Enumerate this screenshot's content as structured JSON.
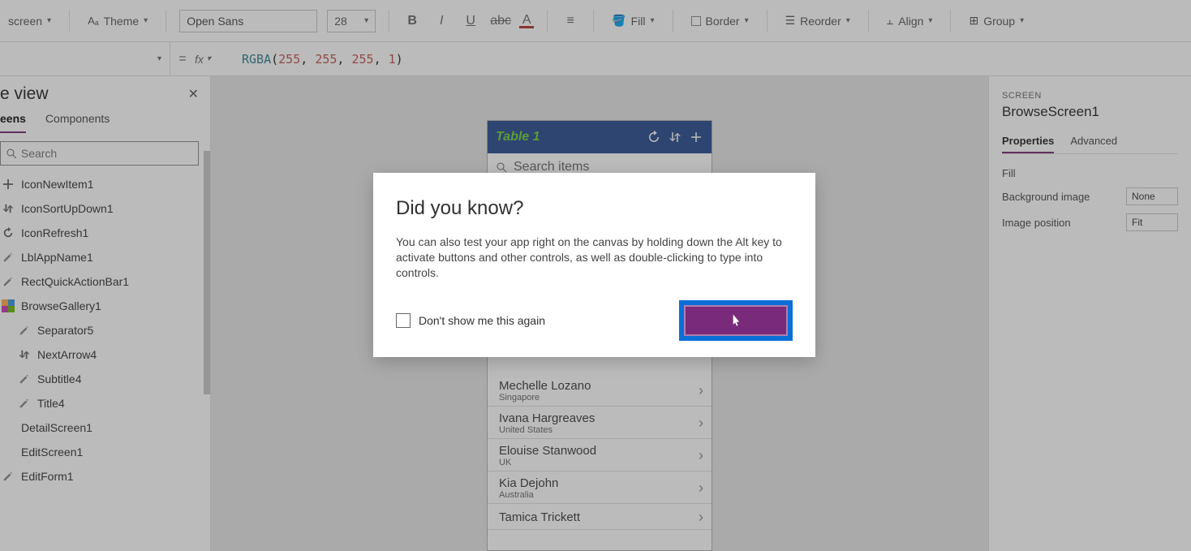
{
  "toolbar": {
    "screen_label": "screen",
    "theme_label": "Theme",
    "font_name": "Open Sans",
    "font_size": "28",
    "fill_label": "Fill",
    "border_label": "Border",
    "reorder_label": "Reorder",
    "align_label": "Align",
    "group_label": "Group"
  },
  "formula": {
    "fn": "RGBA",
    "args": [
      "255",
      "255",
      "255",
      "1"
    ]
  },
  "tree": {
    "title": "e view",
    "tabs": {
      "screens": "eens",
      "components": "Components"
    },
    "search_placeholder": "Search",
    "items": [
      {
        "name": "IconNewItem1",
        "icon": "add",
        "ind": 0
      },
      {
        "name": "IconSortUpDown1",
        "icon": "sort",
        "ind": 0
      },
      {
        "name": "IconRefresh1",
        "icon": "refresh",
        "ind": 0
      },
      {
        "name": "LblAppName1",
        "icon": "edit",
        "ind": 0
      },
      {
        "name": "RectQuickActionBar1",
        "icon": "edit",
        "ind": 0
      },
      {
        "name": "BrowseGallery1",
        "icon": "gal",
        "ind": 0
      },
      {
        "name": "Separator5",
        "icon": "edit",
        "ind": 1
      },
      {
        "name": "NextArrow4",
        "icon": "sort",
        "ind": 1
      },
      {
        "name": "Subtitle4",
        "icon": "edit",
        "ind": 1
      },
      {
        "name": "Title4",
        "icon": "edit",
        "ind": 1
      },
      {
        "name": "DetailScreen1",
        "icon": "",
        "ind": 0
      },
      {
        "name": "EditScreen1",
        "icon": "",
        "ind": 0
      },
      {
        "name": "EditForm1",
        "icon": "edit",
        "ind": 0
      }
    ]
  },
  "phone": {
    "title": "Table 1",
    "search_placeholder": "Search items",
    "rows": [
      {
        "t1": "Mechelle Lozano",
        "t2": "Singapore"
      },
      {
        "t1": "Ivana Hargreaves",
        "t2": "United States"
      },
      {
        "t1": "Elouise Stanwood",
        "t2": "UK"
      },
      {
        "t1": "Kia Dejohn",
        "t2": "Australia"
      },
      {
        "t1": "Tamica Trickett",
        "t2": ""
      }
    ]
  },
  "right": {
    "section": "SCREEN",
    "name": "BrowseScreen1",
    "tabs": {
      "props": "Properties",
      "adv": "Advanced"
    },
    "rows": [
      {
        "label": "Fill",
        "value": ""
      },
      {
        "label": "Background image",
        "value": "None"
      },
      {
        "label": "Image position",
        "value": "Fit"
      }
    ]
  },
  "dialog": {
    "title": "Did you know?",
    "body": "You can also test your app right on the canvas by holding down the Alt key to activate buttons and other controls, as well as double-clicking to type into controls.",
    "checkbox": "Don't show me this again"
  }
}
